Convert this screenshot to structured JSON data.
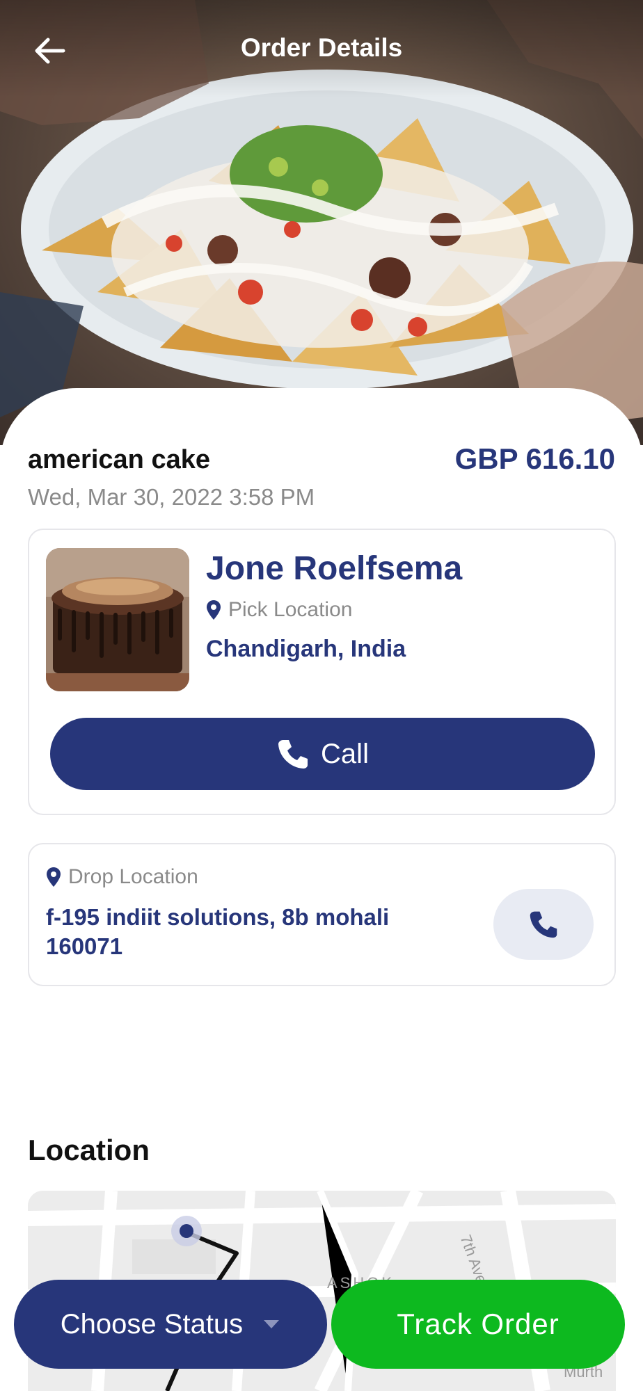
{
  "header": {
    "title": "Order Details",
    "back_icon": "arrow-left-icon"
  },
  "hero": {
    "image": "nachos-food-photo"
  },
  "order": {
    "name": "american cake",
    "price": "GBP 616.10",
    "date": "Wed, Mar 30, 2022 3:58 PM"
  },
  "pickup": {
    "person_name": "Jone Roelfsema",
    "location_label": "Pick Location",
    "city": "Chandigarh, India",
    "call_label": "Call",
    "thumbnail": "chocolate-cake-photo"
  },
  "drop": {
    "location_label": "Drop Location",
    "address": "f-195 indiit solutions, 8b mohali 160071"
  },
  "location_section": {
    "title": "Location",
    "street_labels": [
      "ASHOK",
      "7th Ave",
      "Murth"
    ]
  },
  "bottom_bar": {
    "status_label": "Choose Status",
    "track_label": "Track Order"
  },
  "colors": {
    "primary": "#27367a",
    "accent_green": "#0db91f",
    "muted_text": "#8a8a8a",
    "card_border": "#e6e6ea"
  }
}
